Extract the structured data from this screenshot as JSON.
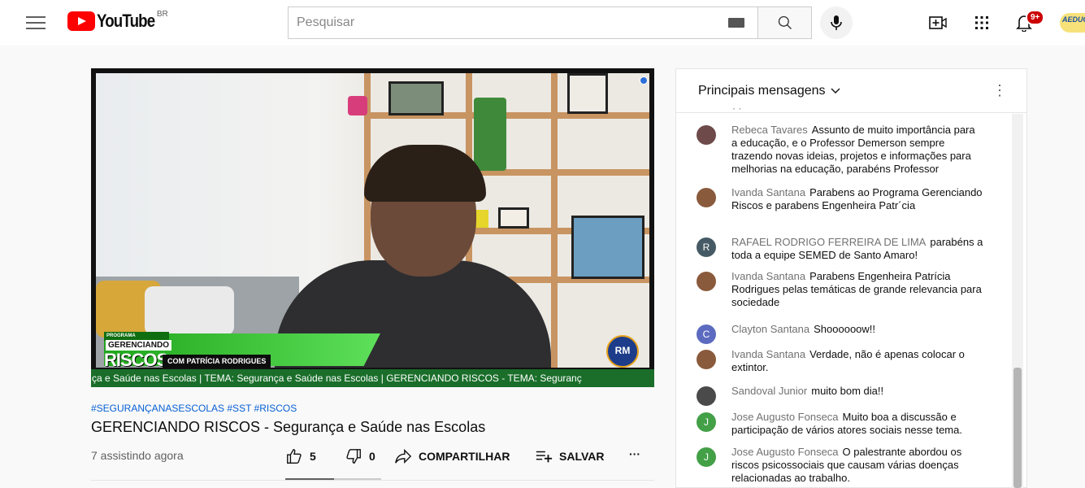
{
  "header": {
    "logo_text": "YouTube",
    "country": "BR",
    "search_placeholder": "Pesquisar",
    "notification_count": "9+",
    "avatar_text": "AEDUC"
  },
  "video": {
    "hashtags": "#SEGURANÇANASESCOLAS #SST #RISCOS",
    "title": "GERENCIANDO RISCOS - Segurança e Saúde nas Escolas",
    "viewers": "7 assistindo agora",
    "like_count": "5",
    "dislike_count": "0",
    "share_label": "COMPARTILHAR",
    "save_label": "SALVAR",
    "more_label": "···",
    "overlay": {
      "programa": "PROGRAMA",
      "gerenciando": "GERENCIANDO",
      "riscos": "RISCOS",
      "com": "COM PATRÍCIA RODRIGUES",
      "rm_logo": "RM",
      "ticker": "ça e Saúde nas Escolas | TEMA: Segurança e Saúde nas Escolas | GERENCIANDO RISCOS - TEMA: Seguranç"
    }
  },
  "chat": {
    "header": "Principais mensagens",
    "messages": [
      {
        "author": "Rebeca Tavares",
        "text": "Assunto de muito importância para a educação, e o Professor Demerson sempre trazendo novas ideias, projetos e informações para melhorias na educação, parabéns Professor",
        "avatar_letter": "",
        "avatar_color": "#6e4a4a"
      },
      {
        "author": "Ivanda Santana",
        "text": "Parabens ao Programa Gerenciando Riscos e parabens Engenheira Patr´cia",
        "avatar_letter": "",
        "avatar_color": "#8a5a3c"
      },
      {
        "author": "RAFAEL RODRIGO FERREIRA DE LIMA",
        "text": "parabéns a toda a equipe SEMED de Santo Amaro!",
        "avatar_letter": "R",
        "avatar_color": "#455a64"
      },
      {
        "author": "Ivanda Santana",
        "text": "Parabens Engenheira Patrícia Rodrigues pelas temáticas de grande relevancia para sociedade",
        "avatar_letter": "",
        "avatar_color": "#8a5a3c"
      },
      {
        "author": "Clayton Santana",
        "text": "Shoooooow!!",
        "avatar_letter": "C",
        "avatar_color": "#5c6bc0"
      },
      {
        "author": "Ivanda Santana",
        "text": "Verdade, não é apenas colocar o extintor.",
        "avatar_letter": "",
        "avatar_color": "#8a5a3c"
      },
      {
        "author": "Sandoval Junior",
        "text": "muito bom dia!!",
        "avatar_letter": "",
        "avatar_color": "#4a4a4a"
      },
      {
        "author": "Jose Augusto Fonseca",
        "text": "Muito boa a discussão e participação de vários atores sociais nesse tema.",
        "avatar_letter": "J",
        "avatar_color": "#43a047"
      },
      {
        "author": "Jose Augusto Fonseca",
        "text": "O palestrante abordou os riscos psicossociais que causam várias doenças relacionadas ao trabalho.",
        "avatar_letter": "J",
        "avatar_color": "#43a047"
      }
    ]
  }
}
